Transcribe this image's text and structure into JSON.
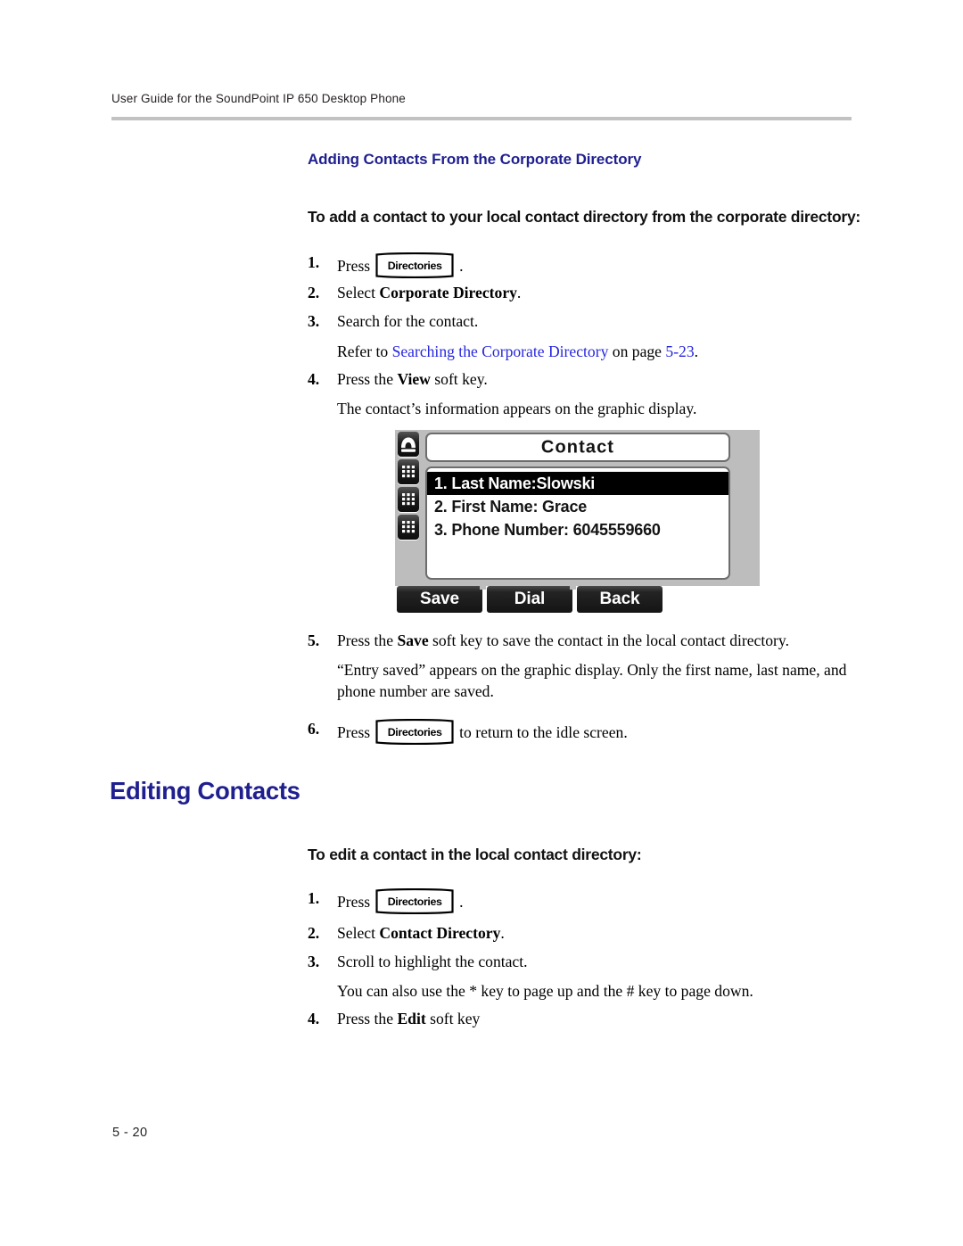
{
  "header": {
    "running_title": "User Guide for the SoundPoint IP 650 Desktop Phone",
    "rule_color": "#c2c2c2"
  },
  "colors": {
    "heading_blue": "#1f1f8f",
    "link_blue": "#2626dd",
    "lcd_background": "#bdbdbd",
    "softkey_dark": "#141414"
  },
  "sections": [
    {
      "id": "adding-contacts",
      "heading": "Adding Contacts From the Corporate Directory",
      "procedure_heading": "To add a contact to your local contact directory from the corporate directory:",
      "steps": [
        {
          "number": "1.",
          "prefix": "Press",
          "keycap": "Directories",
          "suffix": "."
        },
        {
          "number": "2.",
          "prefix": "Select ",
          "bold": "Corporate Directory",
          "suffix": "."
        },
        {
          "number": "3.",
          "text": "Search for the contact."
        },
        {
          "number": "4.",
          "prefix": "Press the ",
          "bold": "View",
          "suffix": " soft key."
        },
        {
          "number": "5.",
          "prefix": "Press the ",
          "bold": "Save",
          "suffix": " soft key to save the contact in the local contact directory."
        },
        {
          "number": "6.",
          "prefix": "Press",
          "keycap": "Directories",
          "suffix": "to return to the idle screen."
        }
      ],
      "notes": {
        "xref_lead": "Refer to ",
        "xref_link": "Searching the Corporate Directory",
        "xref_mid": " on page ",
        "xref_page": "5-23",
        "xref_end": ".",
        "after_step4": "The contact’s information appears on the graphic display.",
        "after_step5": "“Entry saved” appears on the graphic display. Only the first name, last name, and phone number are saved."
      }
    },
    {
      "id": "editing-contacts",
      "heading": "Editing Contacts",
      "procedure_heading": "To edit a contact in the local contact directory:",
      "steps": [
        {
          "number": "1.",
          "prefix": "Press",
          "keycap": "Directories",
          "suffix": "."
        },
        {
          "number": "2.",
          "prefix": "Select ",
          "bold": "Contact Directory",
          "suffix": "."
        },
        {
          "number": "3.",
          "text": "Scroll to highlight the contact."
        },
        {
          "number": "4.",
          "prefix": "Press the ",
          "bold": "Edit",
          "suffix": " soft key"
        }
      ],
      "notes": {
        "after_step3": "You can also use the * key to page up and the # key to page down."
      }
    }
  ],
  "phone_screenshot": {
    "title": "Contact",
    "icons": [
      "handset-icon",
      "line-key-icon",
      "line-key-icon",
      "line-key-icon"
    ],
    "list_items": [
      {
        "label": "1. Last Name:Slowski",
        "selected": true
      },
      {
        "label": "2. First Name: Grace",
        "selected": false
      },
      {
        "label": "3. Phone Number: 6045559660",
        "selected": false
      }
    ],
    "soft_keys": [
      "Save",
      "Dial",
      "Back"
    ]
  },
  "footer": {
    "page_number": "5 - 20"
  }
}
